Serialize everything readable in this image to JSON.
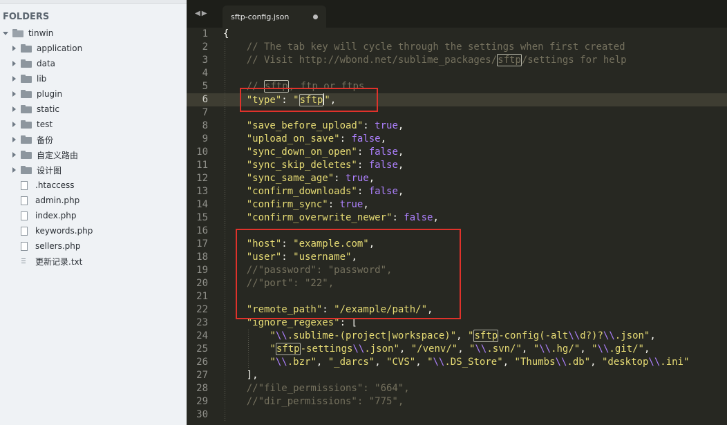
{
  "sidebar": {
    "header": "FOLDERS",
    "root": "tinwin",
    "folders": [
      "application",
      "data",
      "lib",
      "plugin",
      "static",
      "test",
      "备份",
      "自定义路由",
      "设计图"
    ],
    "files": [
      ".htaccess",
      "admin.php",
      "index.php",
      "keywords.php",
      "sellers.php",
      "更新记录.txt"
    ]
  },
  "tabbar": {
    "tab_title": "sftp-config.json"
  },
  "editor": {
    "active_line": 6,
    "lines": [
      {
        "n": "1",
        "segs": [
          {
            "t": "{",
            "c": "p"
          }
        ]
      },
      {
        "n": "2",
        "segs": [
          {
            "t": "    // The tab key will cycle through the settings when first created",
            "c": "c"
          }
        ]
      },
      {
        "n": "3",
        "segs": [
          {
            "t": "    // Visit http://wbond.net/sublime_packages/",
            "c": "c"
          },
          {
            "t": "sftp",
            "c": "c hl"
          },
          {
            "t": "/settings for help",
            "c": "c"
          }
        ]
      },
      {
        "n": "4",
        "segs": []
      },
      {
        "n": "5",
        "segs": [
          {
            "t": "    // ",
            "c": "c"
          },
          {
            "t": "sftp",
            "c": "c hl"
          },
          {
            "t": ", ftp or ftps",
            "c": "c"
          }
        ]
      },
      {
        "n": "6",
        "segs": [
          {
            "t": "    ",
            "c": "p"
          },
          {
            "t": "\"type\"",
            "c": "s"
          },
          {
            "t": ": ",
            "c": "p"
          },
          {
            "t": "\"",
            "c": "s"
          },
          {
            "t": "sftp",
            "c": "s hl"
          },
          {
            "t": "",
            "c": "cursor"
          },
          {
            "t": "\"",
            "c": "s"
          },
          {
            "t": ",",
            "c": "p"
          }
        ]
      },
      {
        "n": "7",
        "segs": []
      },
      {
        "n": "8",
        "segs": [
          {
            "t": "    ",
            "c": "p"
          },
          {
            "t": "\"save_before_upload\"",
            "c": "s"
          },
          {
            "t": ": ",
            "c": "p"
          },
          {
            "t": "true",
            "c": "k"
          },
          {
            "t": ",",
            "c": "p"
          }
        ]
      },
      {
        "n": "9",
        "segs": [
          {
            "t": "    ",
            "c": "p"
          },
          {
            "t": "\"upload_on_save\"",
            "c": "s"
          },
          {
            "t": ": ",
            "c": "p"
          },
          {
            "t": "false",
            "c": "k"
          },
          {
            "t": ",",
            "c": "p"
          }
        ]
      },
      {
        "n": "10",
        "segs": [
          {
            "t": "    ",
            "c": "p"
          },
          {
            "t": "\"sync_down_on_open\"",
            "c": "s"
          },
          {
            "t": ": ",
            "c": "p"
          },
          {
            "t": "false",
            "c": "k"
          },
          {
            "t": ",",
            "c": "p"
          }
        ]
      },
      {
        "n": "11",
        "segs": [
          {
            "t": "    ",
            "c": "p"
          },
          {
            "t": "\"sync_skip_deletes\"",
            "c": "s"
          },
          {
            "t": ": ",
            "c": "p"
          },
          {
            "t": "false",
            "c": "k"
          },
          {
            "t": ",",
            "c": "p"
          }
        ]
      },
      {
        "n": "12",
        "segs": [
          {
            "t": "    ",
            "c": "p"
          },
          {
            "t": "\"sync_same_age\"",
            "c": "s"
          },
          {
            "t": ": ",
            "c": "p"
          },
          {
            "t": "true",
            "c": "k"
          },
          {
            "t": ",",
            "c": "p"
          }
        ]
      },
      {
        "n": "13",
        "segs": [
          {
            "t": "    ",
            "c": "p"
          },
          {
            "t": "\"confirm_downloads\"",
            "c": "s"
          },
          {
            "t": ": ",
            "c": "p"
          },
          {
            "t": "false",
            "c": "k"
          },
          {
            "t": ",",
            "c": "p"
          }
        ]
      },
      {
        "n": "14",
        "segs": [
          {
            "t": "    ",
            "c": "p"
          },
          {
            "t": "\"confirm_sync\"",
            "c": "s"
          },
          {
            "t": ": ",
            "c": "p"
          },
          {
            "t": "true",
            "c": "k"
          },
          {
            "t": ",",
            "c": "p"
          }
        ]
      },
      {
        "n": "15",
        "segs": [
          {
            "t": "    ",
            "c": "p"
          },
          {
            "t": "\"confirm_overwrite_newer\"",
            "c": "s"
          },
          {
            "t": ": ",
            "c": "p"
          },
          {
            "t": "false",
            "c": "k"
          },
          {
            "t": ",",
            "c": "p"
          }
        ]
      },
      {
        "n": "16",
        "segs": []
      },
      {
        "n": "17",
        "segs": [
          {
            "t": "    ",
            "c": "p"
          },
          {
            "t": "\"host\"",
            "c": "s"
          },
          {
            "t": ": ",
            "c": "p"
          },
          {
            "t": "\"example.com\"",
            "c": "s"
          },
          {
            "t": ",",
            "c": "p"
          }
        ]
      },
      {
        "n": "18",
        "segs": [
          {
            "t": "    ",
            "c": "p"
          },
          {
            "t": "\"user\"",
            "c": "s"
          },
          {
            "t": ": ",
            "c": "p"
          },
          {
            "t": "\"username\"",
            "c": "s"
          },
          {
            "t": ",",
            "c": "p"
          }
        ]
      },
      {
        "n": "19",
        "segs": [
          {
            "t": "    //\"password\": \"password\",",
            "c": "c"
          }
        ]
      },
      {
        "n": "20",
        "segs": [
          {
            "t": "    //\"port\": \"22\",",
            "c": "c"
          }
        ]
      },
      {
        "n": "21",
        "segs": []
      },
      {
        "n": "22",
        "segs": [
          {
            "t": "    ",
            "c": "p"
          },
          {
            "t": "\"remote_path\"",
            "c": "s"
          },
          {
            "t": ": ",
            "c": "p"
          },
          {
            "t": "\"/example/path/\"",
            "c": "s"
          },
          {
            "t": ",",
            "c": "p"
          }
        ]
      },
      {
        "n": "23",
        "segs": [
          {
            "t": "    ",
            "c": "p"
          },
          {
            "t": "\"ignore_regexes\"",
            "c": "s"
          },
          {
            "t": ": [",
            "c": "p"
          }
        ]
      },
      {
        "n": "24",
        "segs": [
          {
            "t": "        ",
            "c": "p"
          },
          {
            "t": "\"",
            "c": "s"
          },
          {
            "t": "\\\\",
            "c": "k"
          },
          {
            "t": ".sublime-(project|workspace)\"",
            "c": "s"
          },
          {
            "t": ", ",
            "c": "p"
          },
          {
            "t": "\"",
            "c": "s"
          },
          {
            "t": "sftp",
            "c": "s hl"
          },
          {
            "t": "-config(-alt",
            "c": "s"
          },
          {
            "t": "\\\\",
            "c": "k"
          },
          {
            "t": "d?)?",
            "c": "s"
          },
          {
            "t": "\\\\",
            "c": "k"
          },
          {
            "t": ".json\"",
            "c": "s"
          },
          {
            "t": ",",
            "c": "p"
          }
        ]
      },
      {
        "n": "25",
        "segs": [
          {
            "t": "        ",
            "c": "p"
          },
          {
            "t": "\"",
            "c": "s"
          },
          {
            "t": "sftp",
            "c": "s hl"
          },
          {
            "t": "-settings",
            "c": "s"
          },
          {
            "t": "\\\\",
            "c": "k"
          },
          {
            "t": ".json\"",
            "c": "s"
          },
          {
            "t": ", ",
            "c": "p"
          },
          {
            "t": "\"/venv/\"",
            "c": "s"
          },
          {
            "t": ", ",
            "c": "p"
          },
          {
            "t": "\"",
            "c": "s"
          },
          {
            "t": "\\\\",
            "c": "k"
          },
          {
            "t": ".svn/\"",
            "c": "s"
          },
          {
            "t": ", ",
            "c": "p"
          },
          {
            "t": "\"",
            "c": "s"
          },
          {
            "t": "\\\\",
            "c": "k"
          },
          {
            "t": ".hg/\"",
            "c": "s"
          },
          {
            "t": ", ",
            "c": "p"
          },
          {
            "t": "\"",
            "c": "s"
          },
          {
            "t": "\\\\",
            "c": "k"
          },
          {
            "t": ".git/\"",
            "c": "s"
          },
          {
            "t": ",",
            "c": "p"
          }
        ]
      },
      {
        "n": "26",
        "segs": [
          {
            "t": "        ",
            "c": "p"
          },
          {
            "t": "\"",
            "c": "s"
          },
          {
            "t": "\\\\",
            "c": "k"
          },
          {
            "t": ".bzr\"",
            "c": "s"
          },
          {
            "t": ", ",
            "c": "p"
          },
          {
            "t": "\"_darcs\"",
            "c": "s"
          },
          {
            "t": ", ",
            "c": "p"
          },
          {
            "t": "\"CVS\"",
            "c": "s"
          },
          {
            "t": ", ",
            "c": "p"
          },
          {
            "t": "\"",
            "c": "s"
          },
          {
            "t": "\\\\",
            "c": "k"
          },
          {
            "t": ".DS_Store\"",
            "c": "s"
          },
          {
            "t": ", ",
            "c": "p"
          },
          {
            "t": "\"Thumbs",
            "c": "s"
          },
          {
            "t": "\\\\",
            "c": "k"
          },
          {
            "t": ".db\"",
            "c": "s"
          },
          {
            "t": ", ",
            "c": "p"
          },
          {
            "t": "\"desktop",
            "c": "s"
          },
          {
            "t": "\\\\",
            "c": "k"
          },
          {
            "t": ".ini\"",
            "c": "s"
          }
        ]
      },
      {
        "n": "27",
        "segs": [
          {
            "t": "    ],",
            "c": "p"
          }
        ]
      },
      {
        "n": "28",
        "segs": [
          {
            "t": "    //\"file_permissions\": \"664\",",
            "c": "c"
          }
        ]
      },
      {
        "n": "29",
        "segs": [
          {
            "t": "    //\"dir_permissions\": \"775\",",
            "c": "c"
          }
        ]
      },
      {
        "n": "30",
        "segs": []
      }
    ]
  },
  "colors": {
    "annotation": "#e0322b",
    "background": "#272822"
  }
}
